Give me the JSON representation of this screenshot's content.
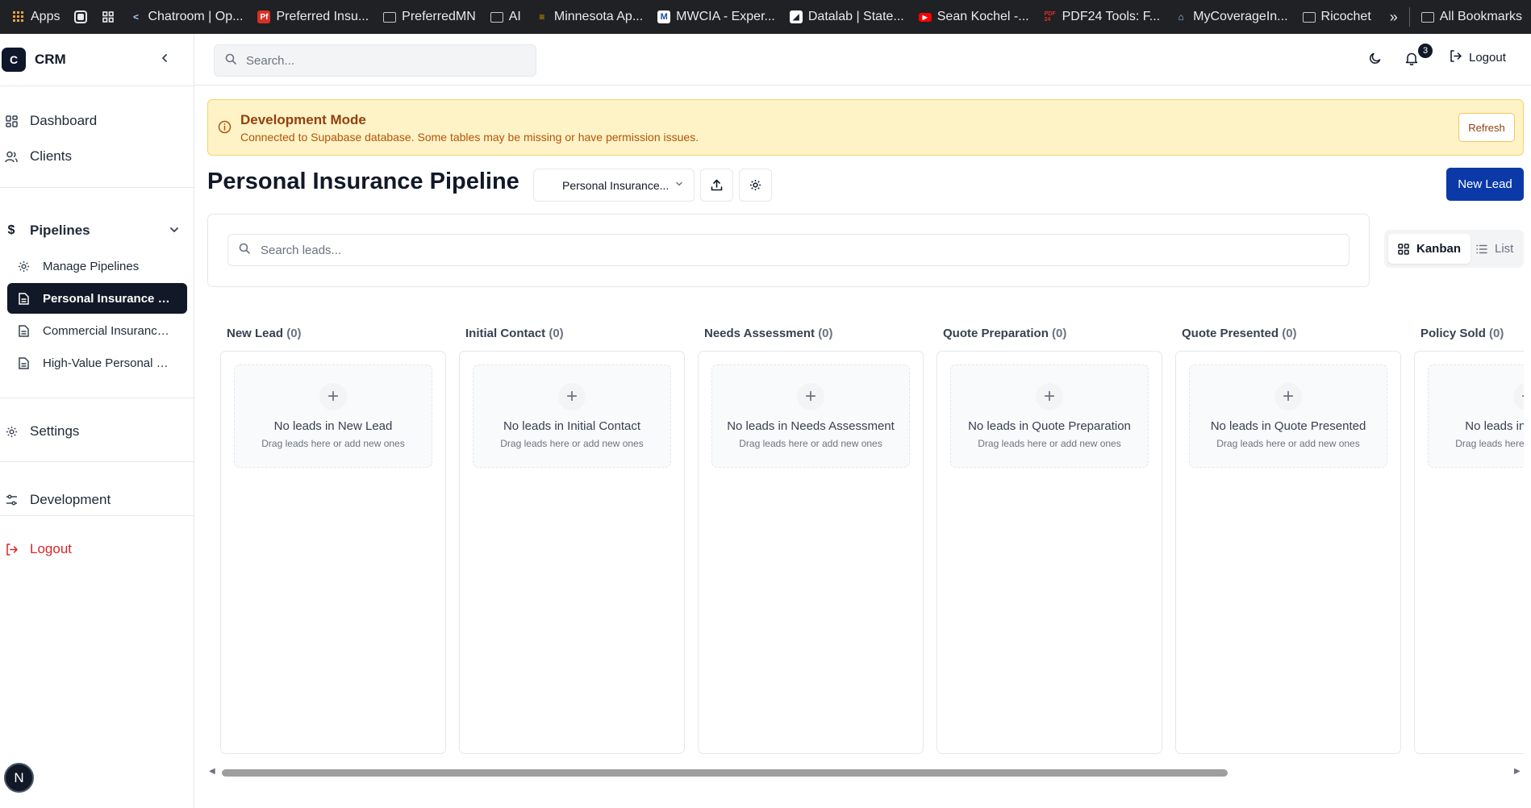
{
  "bookmarks": {
    "items": [
      {
        "label": "Apps",
        "icon": "apps-grid-icon"
      },
      {
        "label": "",
        "icon": "extension-icon"
      },
      {
        "label": "",
        "icon": "grid-icon"
      },
      {
        "label": "Chatroom | Op...",
        "icon": "share-icon"
      },
      {
        "label": "Preferred Insu...",
        "icon": "pf-logo-icon"
      },
      {
        "label": "PreferredMN",
        "icon": "folder-icon"
      },
      {
        "label": "AI",
        "icon": "folder-icon"
      },
      {
        "label": "Minnesota Ap...",
        "icon": "document-icon"
      },
      {
        "label": "MWCIA - Exper...",
        "icon": "m-logo-icon"
      },
      {
        "label": "Datalab | State...",
        "icon": "datalab-icon"
      },
      {
        "label": "Sean Kochel -...",
        "icon": "youtube-icon"
      },
      {
        "label": "PDF24 Tools: F...",
        "icon": "pdf24-icon"
      },
      {
        "label": "MyCoverageIn...",
        "icon": "house-icon"
      },
      {
        "label": "Ricochet",
        "icon": "folder-icon"
      }
    ],
    "more": "»",
    "all_bookmarks": "All Bookmarks"
  },
  "sidebar": {
    "brand_initial": "C",
    "brand_name": "CRM",
    "nav": {
      "dashboard": "Dashboard",
      "clients": "Clients",
      "pipelines": "Pipelines",
      "settings": "Settings",
      "development": "Development",
      "logout": "Logout"
    },
    "pipeline_items": [
      {
        "label": "Manage Pipelines",
        "icon": "gear-icon"
      },
      {
        "label": "Personal Insurance Pipeline",
        "icon": "document-icon",
        "active": true
      },
      {
        "label": "Commercial Insurance Pipeline",
        "icon": "document-icon"
      },
      {
        "label": "High-Value Personal Pipeline",
        "icon": "document-icon"
      }
    ],
    "avatar_initial": "N"
  },
  "header": {
    "search_placeholder": "Search...",
    "notification_count": "3",
    "logout_label": "Logout"
  },
  "banner": {
    "title": "Development Mode",
    "message": "Connected to Supabase database. Some tables may be missing or have permission issues.",
    "refresh_label": "Refresh"
  },
  "page": {
    "title": "Personal Insurance Pipeline",
    "pipeline_select_value": "Personal Insurance...",
    "new_lead_label": "New Lead",
    "leads_search_placeholder": "Search leads...",
    "view_kanban": "Kanban",
    "view_list": "List"
  },
  "kanban": {
    "empty_subtitle": "Drag leads here or add new ones",
    "columns": [
      {
        "name": "New Lead",
        "count": "(0)",
        "empty_text": "No leads in New Lead"
      },
      {
        "name": "Initial Contact",
        "count": "(0)",
        "empty_text": "No leads in Initial Contact"
      },
      {
        "name": "Needs Assessment",
        "count": "(0)",
        "empty_text": "No leads in Needs Assessment"
      },
      {
        "name": "Quote Preparation",
        "count": "(0)",
        "empty_text": "No leads in Quote Preparation"
      },
      {
        "name": "Quote Presented",
        "count": "(0)",
        "empty_text": "No leads in Quote Presented"
      },
      {
        "name": "Policy Sold",
        "count": "(0)",
        "empty_text": "No leads in Policy Sold"
      }
    ]
  },
  "colors": {
    "primary_button": "#0b3aa8",
    "banner_bg": "#fdf3c7",
    "banner_text": "#92400e",
    "active_nav": "#111827",
    "logout_red": "#dc2626"
  }
}
